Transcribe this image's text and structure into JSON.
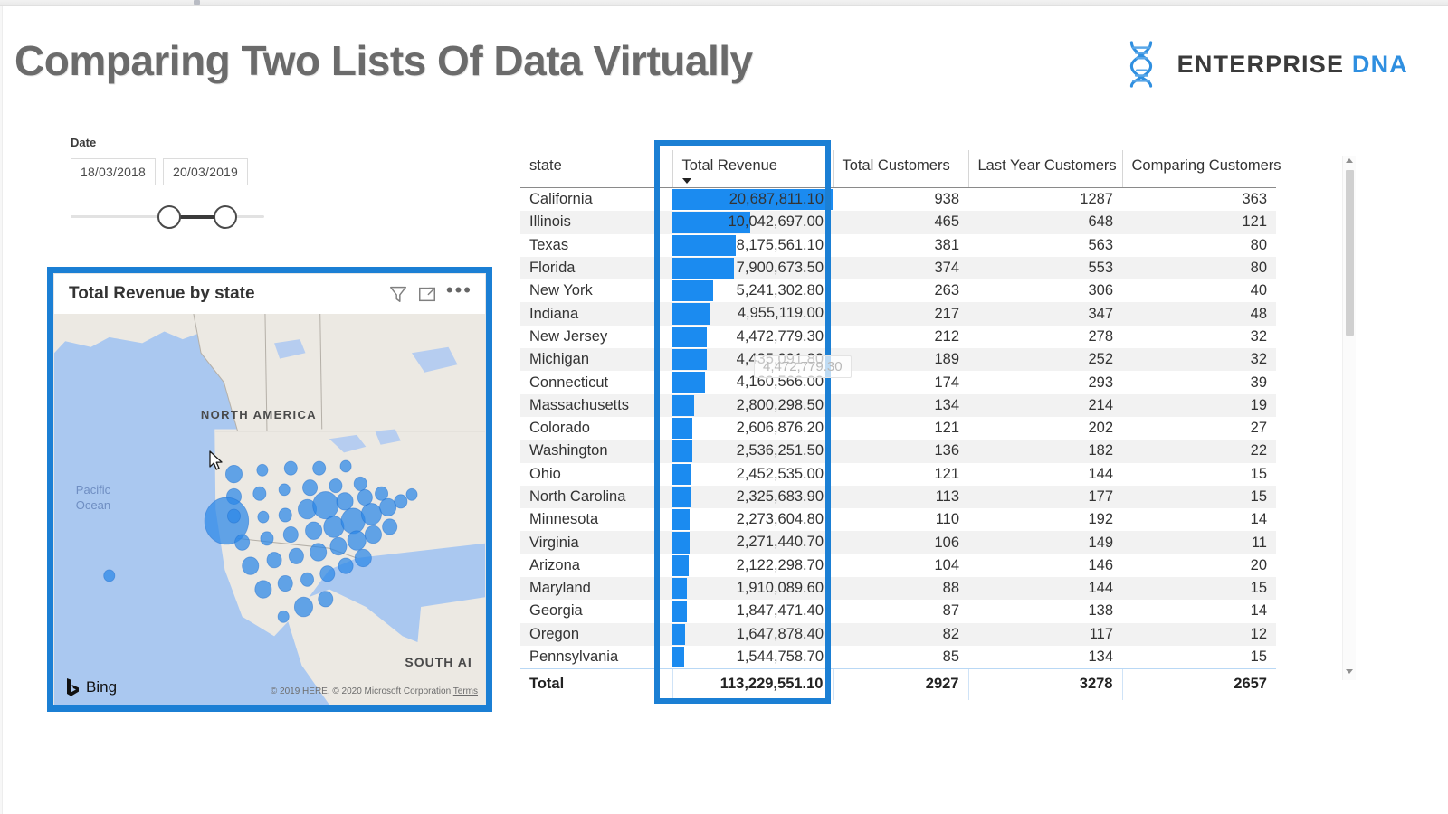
{
  "header": {
    "title": "Comparing Two Lists Of Data Virtually",
    "brand_primary": "ENTERPRISE",
    "brand_secondary": "DNA",
    "brand_icon": "dna-helix-icon"
  },
  "slicer": {
    "label": "Date",
    "start_date": "18/03/2018",
    "end_date": "20/03/2019"
  },
  "map_visual": {
    "title": "Total Revenue by state",
    "filter_icon": "funnel-icon",
    "focus_icon": "focus-mode-icon",
    "more_icon": "ellipsis-icon",
    "provider_label": "Bing",
    "attribution": "© 2019 HERE, © 2020 Microsoft Corporation",
    "attribution_link": "Terms",
    "labels": {
      "north_america": "NORTH AMERICA",
      "pacific_ocean": "Pacific\nOcean",
      "pacific_line1": "Pacific",
      "pacific_line2": "Ocean",
      "south_america": "SOUTH AI"
    }
  },
  "tooltip": {
    "value": "4,472,779.30"
  },
  "colors": {
    "annotation_blue": "#1b7fd4",
    "data_bar_blue": "#1b8bf0",
    "title_grey": "#6b6b6b",
    "brand_blue": "#2f8fe0",
    "map_water": "#aac8f0",
    "map_land": "#ece9e3"
  },
  "chart_data": {
    "type": "table",
    "title": "Total Revenue by state",
    "columns": [
      "state",
      "Total Revenue",
      "Total Customers",
      "Last Year Customers",
      "Comparing Customers"
    ],
    "sorted_by": "Total Revenue",
    "sort_direction": "descending",
    "data_bar_column": "Total Revenue",
    "data_bar_max": 20687811.1,
    "rows": [
      {
        "state": "California",
        "total_revenue": "20,687,811.10",
        "revenue_value": 20687811.1,
        "total_customers": "938",
        "last_year_customers": "1287",
        "comparing_customers": "363"
      },
      {
        "state": "Illinois",
        "total_revenue": "10,042,697.00",
        "revenue_value": 10042697.0,
        "total_customers": "465",
        "last_year_customers": "648",
        "comparing_customers": "121"
      },
      {
        "state": "Texas",
        "total_revenue": "8,175,561.10",
        "revenue_value": 8175561.1,
        "total_customers": "381",
        "last_year_customers": "563",
        "comparing_customers": "80"
      },
      {
        "state": "Florida",
        "total_revenue": "7,900,673.50",
        "revenue_value": 7900673.5,
        "total_customers": "374",
        "last_year_customers": "553",
        "comparing_customers": "80"
      },
      {
        "state": "New York",
        "total_revenue": "5,241,302.80",
        "revenue_value": 5241302.8,
        "total_customers": "263",
        "last_year_customers": "306",
        "comparing_customers": "40"
      },
      {
        "state": "Indiana",
        "total_revenue": "4,955,119.00",
        "revenue_value": 4955119.0,
        "total_customers": "217",
        "last_year_customers": "347",
        "comparing_customers": "48"
      },
      {
        "state": "New Jersey",
        "total_revenue": "4,472,779.30",
        "revenue_value": 4472779.3,
        "total_customers": "212",
        "last_year_customers": "278",
        "comparing_customers": "32"
      },
      {
        "state": "Michigan",
        "total_revenue": "4,435,091.80",
        "revenue_value": 4435091.8,
        "total_customers": "189",
        "last_year_customers": "252",
        "comparing_customers": "32"
      },
      {
        "state": "Connecticut",
        "total_revenue": "4,160,566.00",
        "revenue_value": 4160566.0,
        "total_customers": "174",
        "last_year_customers": "293",
        "comparing_customers": "39"
      },
      {
        "state": "Massachusetts",
        "total_revenue": "2,800,298.50",
        "revenue_value": 2800298.5,
        "total_customers": "134",
        "last_year_customers": "214",
        "comparing_customers": "19"
      },
      {
        "state": "Colorado",
        "total_revenue": "2,606,876.20",
        "revenue_value": 2606876.2,
        "total_customers": "121",
        "last_year_customers": "202",
        "comparing_customers": "27"
      },
      {
        "state": "Washington",
        "total_revenue": "2,536,251.50",
        "revenue_value": 2536251.5,
        "total_customers": "136",
        "last_year_customers": "182",
        "comparing_customers": "22"
      },
      {
        "state": "Ohio",
        "total_revenue": "2,452,535.00",
        "revenue_value": 2452535.0,
        "total_customers": "121",
        "last_year_customers": "144",
        "comparing_customers": "15"
      },
      {
        "state": "North Carolina",
        "total_revenue": "2,325,683.90",
        "revenue_value": 2325683.9,
        "total_customers": "113",
        "last_year_customers": "177",
        "comparing_customers": "15"
      },
      {
        "state": "Minnesota",
        "total_revenue": "2,273,604.80",
        "revenue_value": 2273604.8,
        "total_customers": "110",
        "last_year_customers": "192",
        "comparing_customers": "14"
      },
      {
        "state": "Virginia",
        "total_revenue": "2,271,440.70",
        "revenue_value": 2271440.7,
        "total_customers": "106",
        "last_year_customers": "149",
        "comparing_customers": "11"
      },
      {
        "state": "Arizona",
        "total_revenue": "2,122,298.70",
        "revenue_value": 2122298.7,
        "total_customers": "104",
        "last_year_customers": "146",
        "comparing_customers": "20"
      },
      {
        "state": "Maryland",
        "total_revenue": "1,910,089.60",
        "revenue_value": 1910089.6,
        "total_customers": "88",
        "last_year_customers": "144",
        "comparing_customers": "15"
      },
      {
        "state": "Georgia",
        "total_revenue": "1,847,471.40",
        "revenue_value": 1847471.4,
        "total_customers": "87",
        "last_year_customers": "138",
        "comparing_customers": "14"
      },
      {
        "state": "Oregon",
        "total_revenue": "1,647,878.40",
        "revenue_value": 1647878.4,
        "total_customers": "82",
        "last_year_customers": "117",
        "comparing_customers": "12"
      },
      {
        "state": "Pennsylvania",
        "total_revenue": "1,544,758.70",
        "revenue_value": 1544758.7,
        "total_customers": "85",
        "last_year_customers": "134",
        "comparing_customers": "15"
      }
    ],
    "total_row": {
      "label": "Total",
      "total_revenue": "113,229,551.10",
      "total_customers": "2927",
      "last_year_customers": "3278",
      "comparing_customers": "2657"
    }
  }
}
